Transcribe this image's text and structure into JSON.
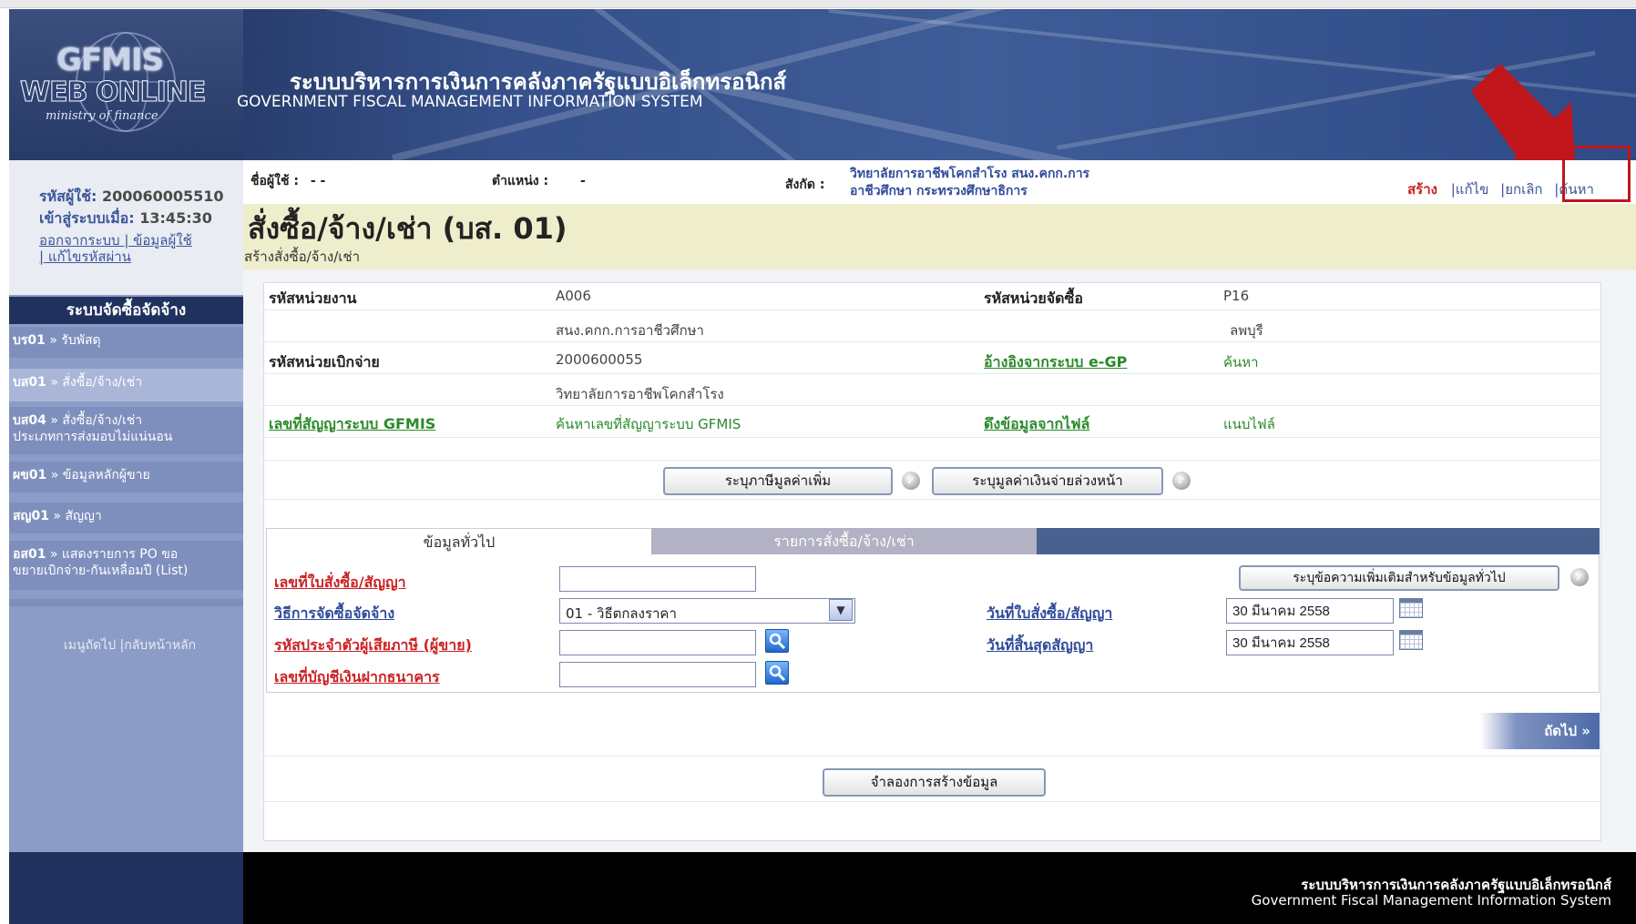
{
  "header": {
    "logo_line1": "GFMIS",
    "logo_line2": "WEB ONLINE",
    "logo_line3": "ministry of finance",
    "title_th": "ระบบบริหารการเงินการคลังภาครัฐแบบอิเล็กทรอนิกส์",
    "title_en": "GOVERNMENT FISCAL MANAGEMENT INFORMATION SYSTEM"
  },
  "session": {
    "user_code_label": "รหัสผู้ใช้:",
    "user_code": "200060005510",
    "login_label": "เข้าสู่ระบบเมื่อ:",
    "login_time": "13:45:30",
    "links_line1": "ออกจากระบบ | ข้อมูลผู้ใช้",
    "links_line2": "| แก้ไขรหัสผ่าน"
  },
  "infobar": {
    "user_label": "ชื่อผู้ใช้ :",
    "user_value": "- -",
    "position_label": "ตำแหน่ง :",
    "position_value": "-",
    "affil_label": "สังกัด :",
    "affil_line1": "วิทยาลัยการอาชีพโคกสำโรง สนง.คกก.การ",
    "affil_line2": "อาชีวศึกษา กระทรวงศึกษาธิการ"
  },
  "actions": {
    "create": "สร้าง",
    "edit": "|แก้ไข",
    "cancel": "|ยกเลิก",
    "search": "|ค้นหา"
  },
  "sidebar": {
    "menu_title": "ระบบจัดซื้อจัดจ้าง",
    "items": [
      {
        "code": "บร01",
        "label": "» รับพัสดุ"
      },
      {
        "code": "บส01",
        "label": "» สั่งซื้อ/จ้าง/เช่า"
      },
      {
        "code": "บส04",
        "label": "» สั่งซื้อ/จ้าง/เช่า",
        "label2": "ประเภทการส่งมอบไม่แน่นอน"
      },
      {
        "code": "ผข01",
        "label": "» ข้อมูลหลักผู้ขาย"
      },
      {
        "code": "สญ01",
        "label": "» สัญญา"
      },
      {
        "code": "อส01",
        "label": "» แสดงรายการ PO ขอ",
        "label2": "ขยายเบิกจ่าย-กันเหลื่อมปี (List)"
      }
    ],
    "footer_links": "เมนูถัดไป |กลับหน้าหลัก"
  },
  "page": {
    "title": "สั่งซื้อ/จ้าง/เช่า (บส. 01)",
    "subtitle": "สร้างสั่งซื้อ/จ้าง/เช่า"
  },
  "form": {
    "agency_code_label": "รหัสหน่วยงาน",
    "agency_code": "A006",
    "agency_name": "สนง.คกก.การอาชีวศึกษา",
    "purch_unit_label": "รหัสหน่วยจัดซื้อ",
    "purch_unit": "P16",
    "purch_unit_name": "ลพบุรี",
    "disb_unit_label": "รหัสหน่วยเบิกจ่าย",
    "disb_unit": "2000600055",
    "disb_unit_name": "วิทยาลัยการอาชีพโคกสำโรง",
    "egp_label": "อ้างอิงจากระบบ e-GP",
    "egp_value": "ค้นหา",
    "contract_gfmis_label": "เลขที่สัญญาระบบ GFMIS",
    "contract_gfmis_value": "ค้นหาเลขที่สัญญาระบบ GFMIS",
    "file_label": "ดึงข้อมูลจากไฟล์",
    "file_value": "แนบไฟล์",
    "vat_button": "ระบุภาษีมูลค่าเพิ่ม",
    "prepay_button": "ระบุมูลค่าเงินจ่ายล่วงหน้า"
  },
  "tabs": {
    "general": "ข้อมูลทั่วไป",
    "items": "รายการสั่งซื้อ/จ้าง/เช่า"
  },
  "general": {
    "po_no_label": "เลขที่ใบสั่งซื้อ/สัญญา",
    "po_no_value": "",
    "method_label": "วิธีการจัดซื้อจัดจ้าง",
    "method_value": "01 - วิธีตกลงราคา",
    "tax_id_label": "รหัสประจำตัวผู้เสียภาษี (ผู้ขาย)",
    "tax_id_value": "",
    "bank_label": "เลขที่บัญชีเงินฝากธนาคาร",
    "bank_value": "",
    "extra_button": "ระบุข้อความเพิ่มเติมสำหรับข้อมูลทั่วไป",
    "po_date_label": "วันที่ใบสั่งซื้อ/สัญญา",
    "po_date_value": "30 มีนาคม 2558",
    "end_date_label": "วันที่สิ้นสุดสัญญา",
    "end_date_value": "30 มีนาคม 2558",
    "next_label": "ถัดไป »",
    "simulate_button": "จำลองการสร้างข้อมูล"
  },
  "footer": {
    "line1": "ระบบบริหารการเงินการคลังภาครัฐแบบอิเล็กทรอนิกส์",
    "line2": "Government Fiscal Management Information System"
  },
  "colors": {
    "annotation_red": "#c0161b",
    "menu_header": "#20315e",
    "link_red": "#cc2222",
    "link_green": "#2b8a2b"
  }
}
